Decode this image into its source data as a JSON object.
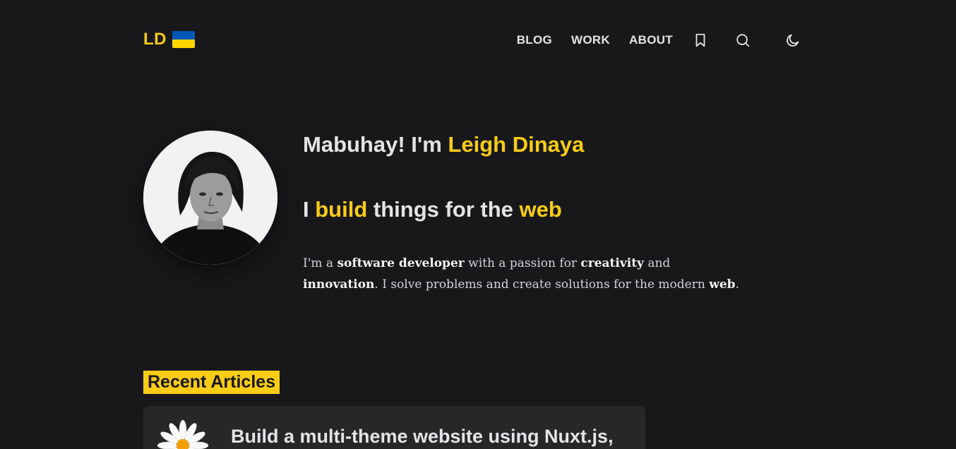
{
  "header": {
    "logo_text": "LD",
    "flag": {
      "icon": "ukraine-flag-icon",
      "colors": [
        "#0057b7",
        "#ffd700"
      ]
    },
    "nav": [
      {
        "label": "BLOG"
      },
      {
        "label": "WORK"
      },
      {
        "label": "ABOUT"
      }
    ],
    "icons": [
      "bookmark-icon",
      "search-icon",
      "moon-icon"
    ]
  },
  "hero": {
    "greeting_prefix": "Mabuhay! I'm ",
    "name": "Leigh Dinaya",
    "tagline_prefix": "I ",
    "tagline_highlight_1": "build",
    "tagline_middle": " things for the ",
    "tagline_highlight_2": "web",
    "bio": {
      "p1": "I'm a ",
      "b1": "software developer",
      "p2": " with a passion for ",
      "b2": "creativity",
      "p3": " and ",
      "b3": "innovation",
      "p4": ". I solve problems and create solutions for the modern ",
      "b4": "web",
      "p5": "."
    }
  },
  "recent": {
    "title": "Recent Articles",
    "articles": [
      {
        "title": "Build a multi-theme website using Nuxt.js,",
        "thumb_icon": "daisy-icon"
      }
    ]
  },
  "colors": {
    "background": "#18181b",
    "accent": "#facc15",
    "text": "#e4e4e7",
    "card": "#27272a"
  }
}
